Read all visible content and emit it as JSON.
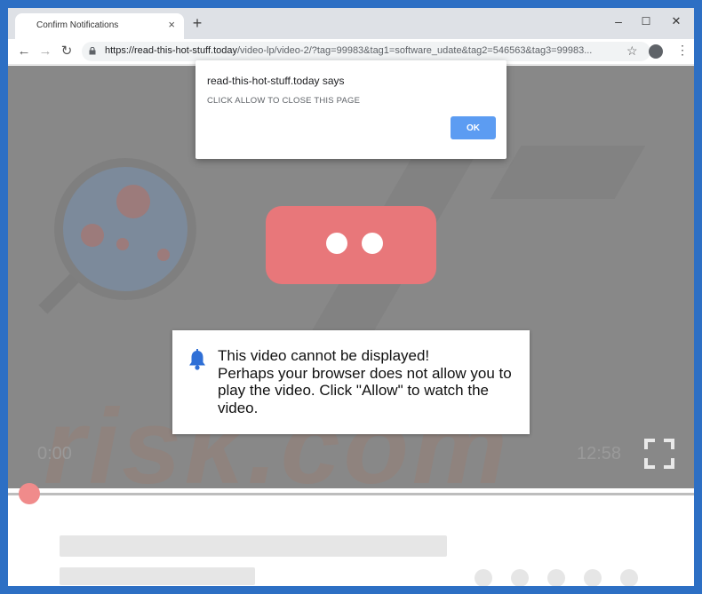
{
  "browser": {
    "tab_title": "Confirm Notifications",
    "tab_close": "×",
    "new_tab": "+",
    "window_controls": {
      "minimize": "–",
      "maximize": "☐",
      "close": "✕"
    },
    "nav": {
      "back": "←",
      "forward": "→",
      "reload": "↻"
    },
    "url_domain": "https://read-this-hot-stuff.today",
    "url_path": "/video-lp/video-2/?tag=99983&tag1=software_udate&tag2=546563&tag3=99983...",
    "star": "☆",
    "menu": "⋮"
  },
  "alert": {
    "title": "read-this-hot-stuff.today says",
    "message": "CLICK ALLOW TO CLOSE THIS PAGE",
    "ok_label": "OK"
  },
  "notice": {
    "line1": "This video cannot be displayed!",
    "line2": "Perhaps your browser does not allow you to",
    "line3": "play the video. Click \"Allow\" to watch the",
    "line4": "video."
  },
  "player": {
    "time_current": "0:00",
    "time_total": "12:58",
    "progress": 0
  },
  "watermark": {
    "text": "risk.com"
  },
  "colors": {
    "accent": "#5c9cf2",
    "bell": "#2f6fd6",
    "progress_knob": "#f08b8b"
  }
}
